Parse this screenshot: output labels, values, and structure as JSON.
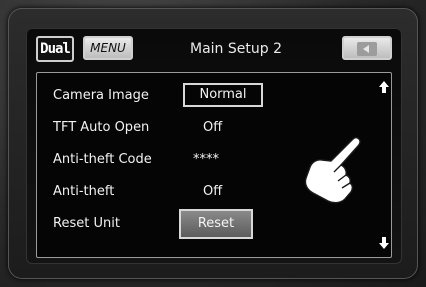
{
  "header": {
    "logo_text": "Dual",
    "menu_label": "MENU",
    "title": "Main  Setup 2",
    "back_icon": "back-icon"
  },
  "settings": [
    {
      "label": "Camera Image",
      "value": "Normal",
      "style": "box"
    },
    {
      "label": "TFT Auto Open",
      "value": "Off",
      "style": "text"
    },
    {
      "label": "Anti-theft Code",
      "value": "****",
      "style": "text"
    },
    {
      "label": "Anti-theft",
      "value": "Off",
      "style": "text"
    },
    {
      "label": "Reset Unit",
      "value": "Reset",
      "style": "button"
    }
  ],
  "scroll": {
    "up_icon": "arrow-up-icon",
    "down_icon": "arrow-down-icon"
  },
  "pointer_icon": "hand-pointer-icon"
}
